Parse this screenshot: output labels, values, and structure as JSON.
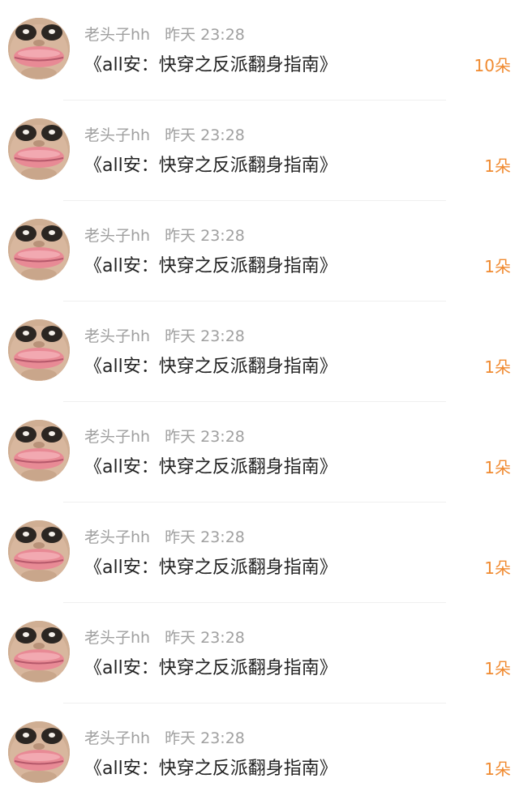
{
  "accent_color": "#f08a30",
  "avatar_icon": "face-avatar",
  "notifications": [
    {
      "user": "老头子hh",
      "time": "昨天 23:28",
      "title": "《all安：快穿之反派翻身指南》",
      "count": "10朵"
    },
    {
      "user": "老头子hh",
      "time": "昨天 23:28",
      "title": "《all安：快穿之反派翻身指南》",
      "count": "1朵"
    },
    {
      "user": "老头子hh",
      "time": "昨天 23:28",
      "title": "《all安：快穿之反派翻身指南》",
      "count": "1朵"
    },
    {
      "user": "老头子hh",
      "time": "昨天 23:28",
      "title": "《all安：快穿之反派翻身指南》",
      "count": "1朵"
    },
    {
      "user": "老头子hh",
      "time": "昨天 23:28",
      "title": "《all安：快穿之反派翻身指南》",
      "count": "1朵"
    },
    {
      "user": "老头子hh",
      "time": "昨天 23:28",
      "title": "《all安：快穿之反派翻身指南》",
      "count": "1朵"
    },
    {
      "user": "老头子hh",
      "time": "昨天 23:28",
      "title": "《all安：快穿之反派翻身指南》",
      "count": "1朵"
    },
    {
      "user": "老头子hh",
      "time": "昨天 23:28",
      "title": "《all安：快穿之反派翻身指南》",
      "count": "1朵"
    }
  ]
}
